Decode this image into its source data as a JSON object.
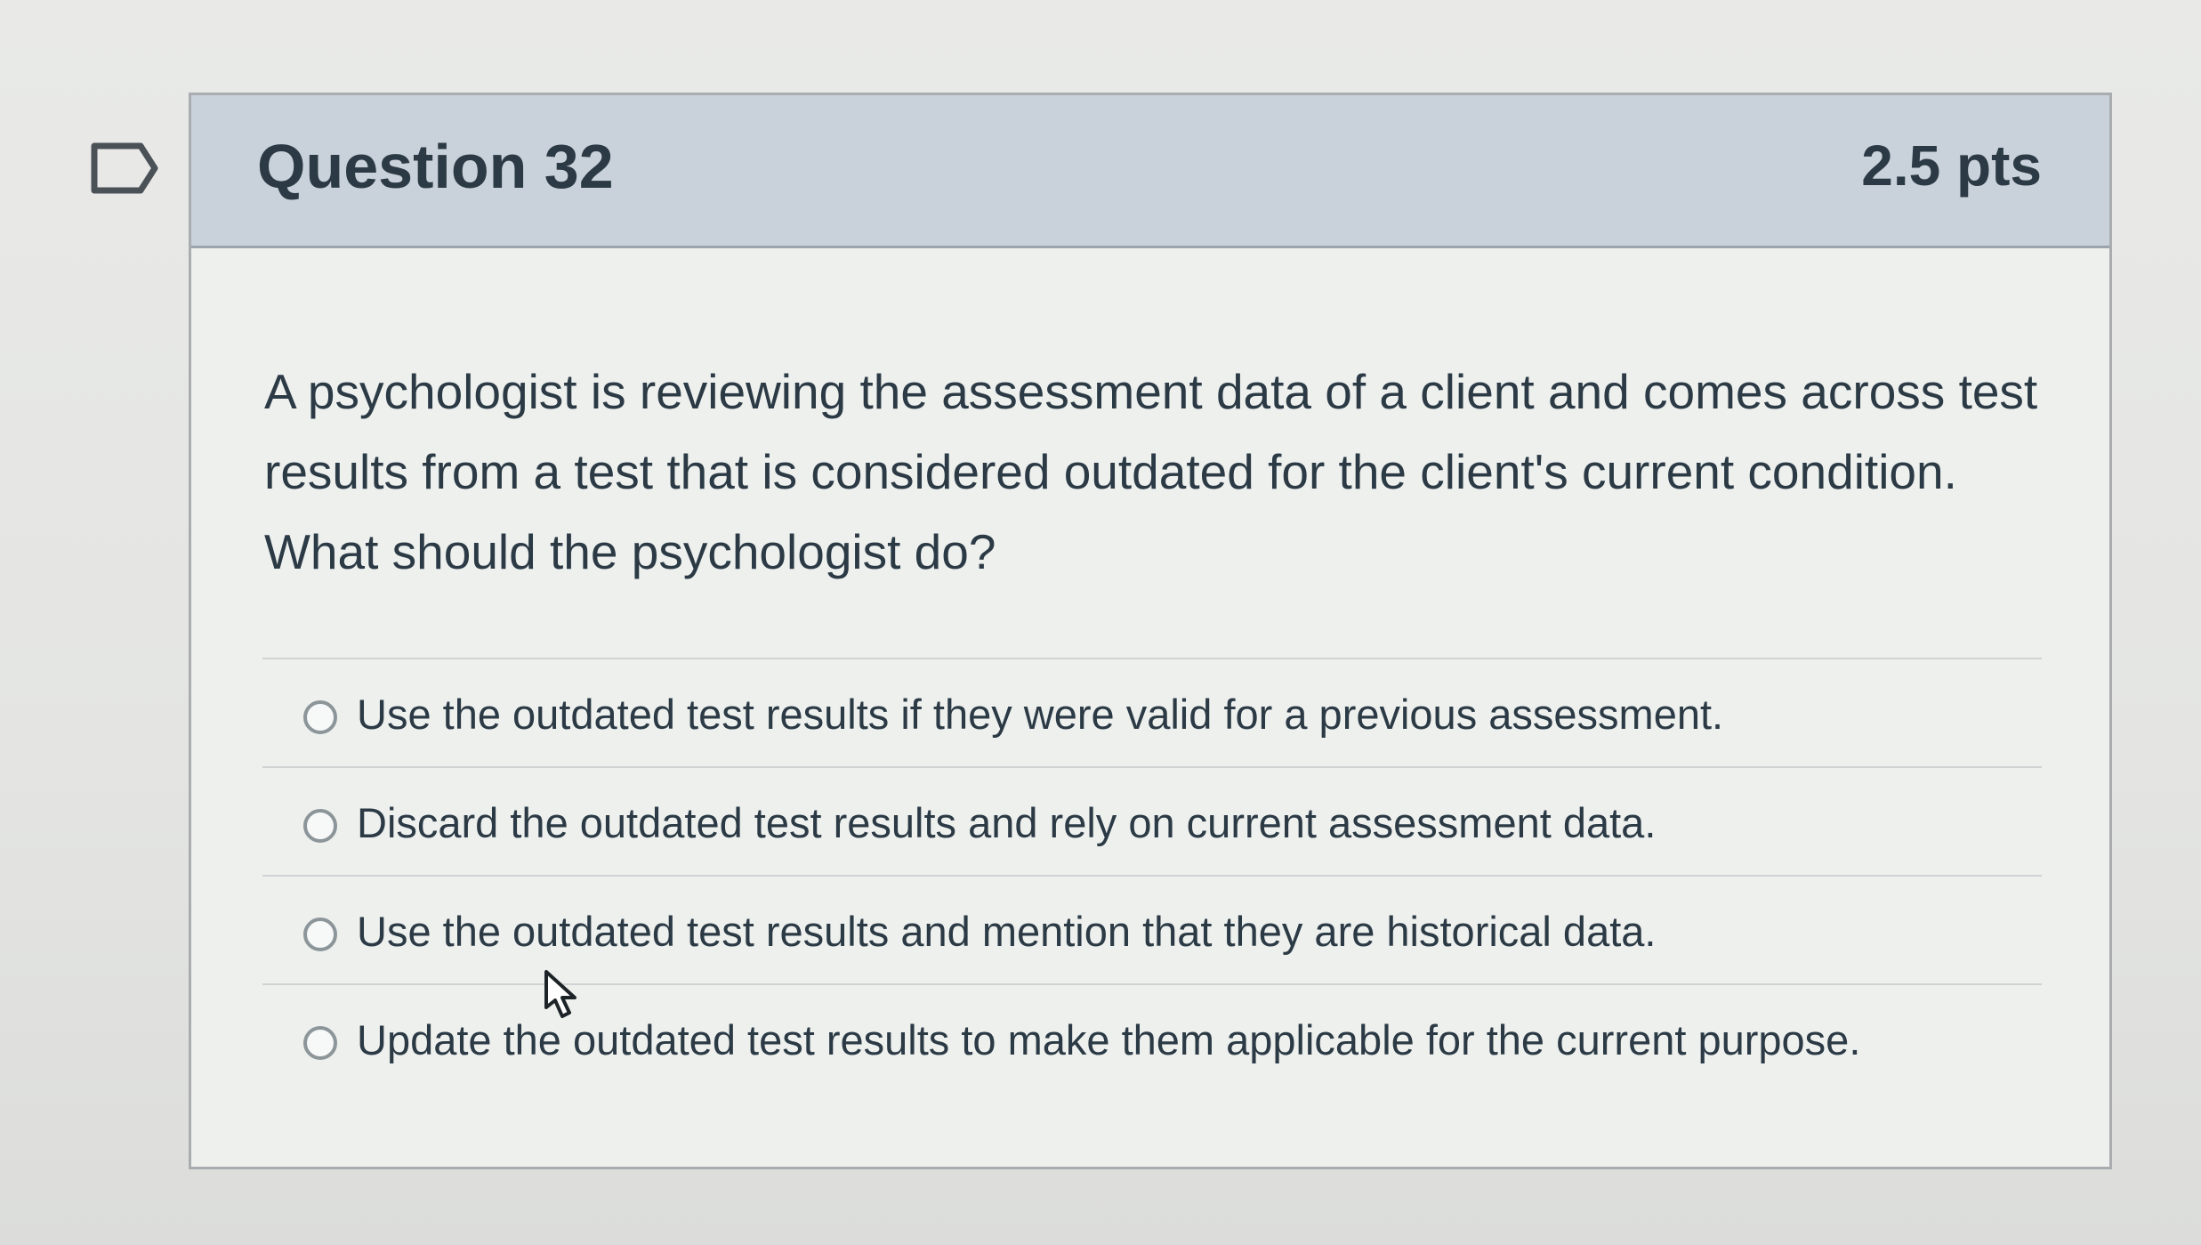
{
  "question": {
    "title": "Question 32",
    "points": "2.5 pts",
    "text": "A psychologist is reviewing the assessment data of a client and comes across test results from a test that is considered outdated for the client's current condition. What should the psychologist do?",
    "answers": [
      {
        "label": "Use the outdated test results if they were valid for a previous assessment."
      },
      {
        "label": "Discard the outdated test results and rely on current assessment data."
      },
      {
        "label": "Use the outdated test results and mention that they are historical data."
      },
      {
        "label": "Update the outdated test results to make them applicable for the current purpose."
      }
    ]
  },
  "icons": {
    "flag": "flag-outline-icon",
    "cursor": "hand-pointer-icon",
    "radio": "radio-unselected-icon"
  },
  "colors": {
    "header_background": "#c9d1da",
    "text": "#2b3a45",
    "card_border": "#a9adb0"
  }
}
